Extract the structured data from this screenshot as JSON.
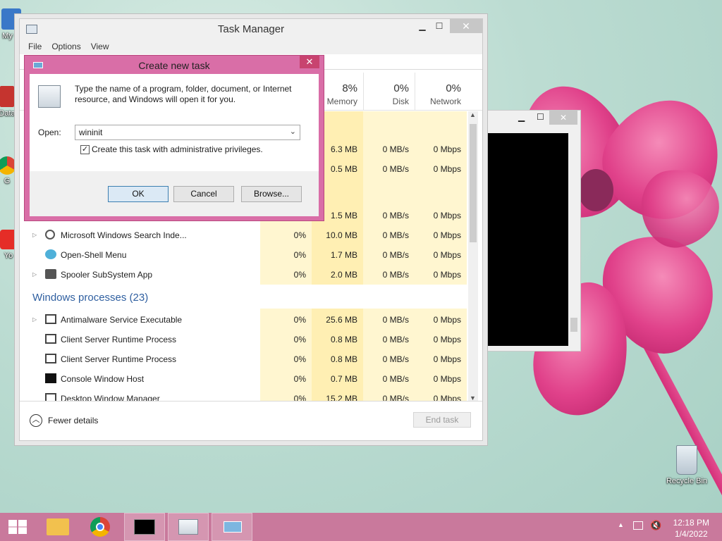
{
  "desktop": {
    "icons": [
      {
        "label": "My C"
      },
      {
        "label": "Data"
      },
      {
        "label": "G"
      },
      {
        "label": "Yo"
      },
      {
        "label": "Recycle Bin"
      }
    ]
  },
  "task_manager": {
    "title": "Task Manager",
    "menu": [
      "File",
      "Options",
      "View"
    ],
    "columns": [
      {
        "pct": "8%",
        "label": "Memory"
      },
      {
        "pct": "0%",
        "label": "Disk"
      },
      {
        "pct": "0%",
        "label": "Network"
      }
    ],
    "rows": [
      {
        "name": "",
        "cpu": "",
        "mem": "6.3 MB",
        "disk": "0 MB/s",
        "net": "0 Mbps"
      },
      {
        "name": "",
        "cpu": "",
        "mem": "0.5 MB",
        "disk": "0 MB/s",
        "net": "0 Mbps"
      },
      {
        "name": "",
        "cpu": "",
        "mem": "",
        "disk": "",
        "net": ""
      },
      {
        "name": "",
        "cpu": "",
        "mem": "1.5 MB",
        "disk": "0 MB/s",
        "net": "0 Mbps"
      },
      {
        "name": "Microsoft Windows Search Inde...",
        "cpu": "0%",
        "mem": "10.0 MB",
        "disk": "0 MB/s",
        "net": "0 Mbps"
      },
      {
        "name": "Open-Shell Menu",
        "cpu": "0%",
        "mem": "1.7 MB",
        "disk": "0 MB/s",
        "net": "0 Mbps"
      },
      {
        "name": "Spooler SubSystem App",
        "cpu": "0%",
        "mem": "2.0 MB",
        "disk": "0 MB/s",
        "net": "0 Mbps"
      }
    ],
    "group_label": "Windows processes (23)",
    "win_rows": [
      {
        "name": "Antimalware Service Executable",
        "cpu": "0%",
        "mem": "25.6 MB",
        "disk": "0 MB/s",
        "net": "0 Mbps"
      },
      {
        "name": "Client Server Runtime Process",
        "cpu": "0%",
        "mem": "0.8 MB",
        "disk": "0 MB/s",
        "net": "0 Mbps"
      },
      {
        "name": "Client Server Runtime Process",
        "cpu": "0%",
        "mem": "0.8 MB",
        "disk": "0 MB/s",
        "net": "0 Mbps"
      },
      {
        "name": "Console Window Host",
        "cpu": "0%",
        "mem": "0.7 MB",
        "disk": "0 MB/s",
        "net": "0 Mbps"
      },
      {
        "name": "Desktop Window Manager",
        "cpu": "0%",
        "mem": "15.2 MB",
        "disk": "0 MB/s",
        "net": "0 Mbps"
      }
    ],
    "fewer_details": "Fewer details",
    "end_task": "End task"
  },
  "dialog": {
    "title": "Create new task",
    "description": "Type the name of a program, folder, document, or Internet resource, and Windows will open it for you.",
    "open_label": "Open:",
    "open_value": "wininit",
    "admin_checkbox_label": "Create this task with administrative privileges.",
    "admin_checked": true,
    "ok": "OK",
    "cancel": "Cancel",
    "browse": "Browse..."
  },
  "taskbar": {
    "time": "12:18 PM",
    "date": "1/4/2022"
  }
}
